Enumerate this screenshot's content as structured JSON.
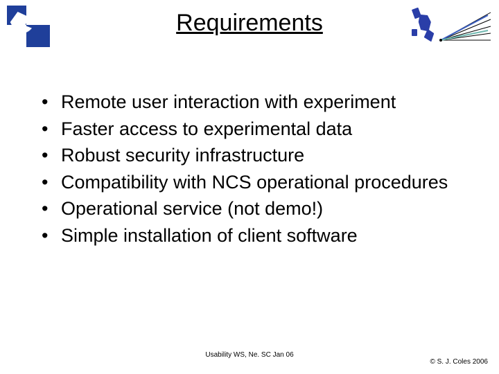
{
  "title": "Requirements",
  "bullets": [
    "Remote user interaction with experiment",
    "Faster access to experimental data",
    "Robust security infrastructure",
    "Compatibility with NCS operational procedures",
    "Operational service (not demo!)",
    "Simple installation of client software"
  ],
  "footer": {
    "center": "Usability WS, Ne. SC Jan 06",
    "right": "© S. J. Coles 2006"
  }
}
